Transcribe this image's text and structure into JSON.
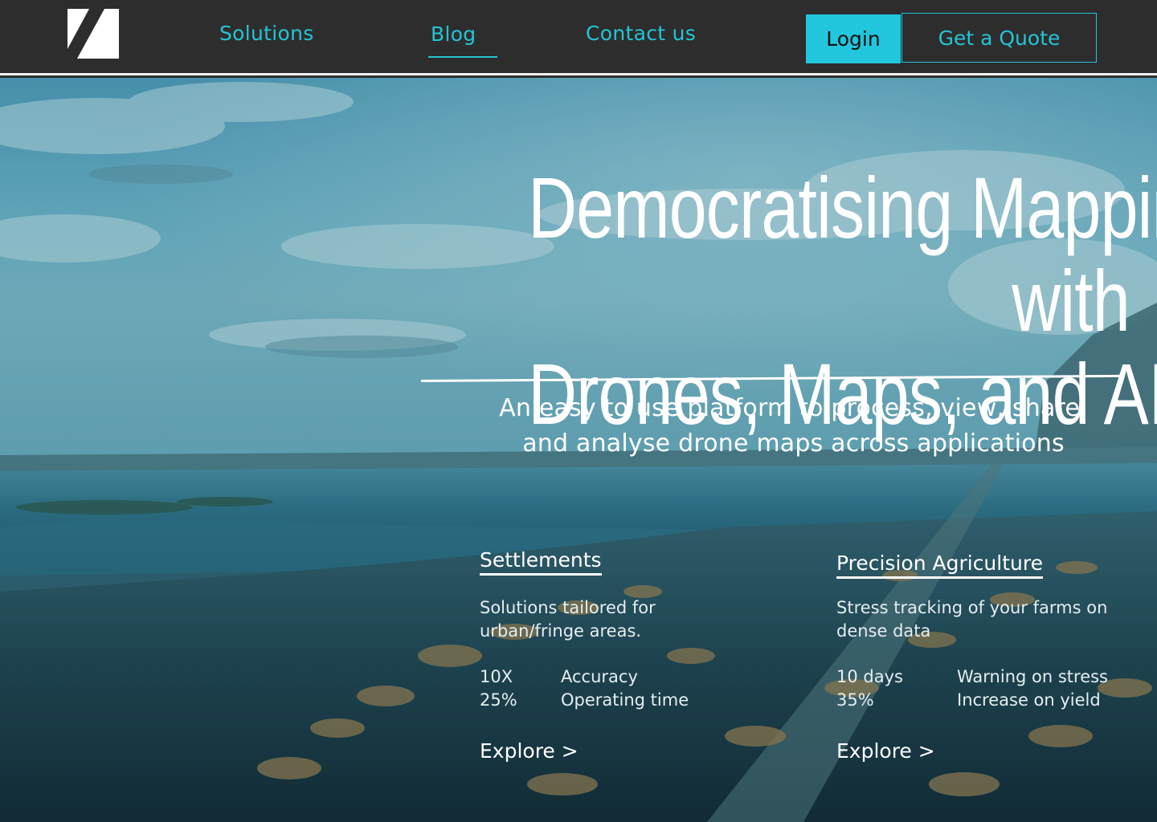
{
  "nav": {
    "logo": "logo",
    "links": [
      "Solutions",
      "Blog",
      "Contact us"
    ],
    "active_link": "Blog",
    "login_label": "Login",
    "quote_label": "Get a Quote"
  },
  "hero": {
    "headline_lines": [
      "Democratising Mapping",
      "with",
      "Drones, Maps, and AI"
    ],
    "subtitle_lines": [
      "An easy to use platform to process, view, share,",
      "and analyse drone maps across applications"
    ]
  },
  "cards": [
    {
      "title": "Settlements",
      "desc_lines": [
        "Solutions tailored for",
        "urban/fringe areas."
      ],
      "stats": [
        {
          "value": "10X",
          "label": "Accuracy"
        },
        {
          "value": "25%",
          "label": "Operating time"
        }
      ],
      "cta": "Explore >"
    },
    {
      "title": "Precision Agriculture",
      "desc_lines": [
        "Stress tracking of your farms on",
        "dense data"
      ],
      "stats": [
        {
          "value": "10 days",
          "label": "Warning on stress"
        },
        {
          "value": "35%",
          "label": " Increase on yield"
        }
      ],
      "cta": "Explore >"
    }
  ],
  "colors": {
    "accent": "#22c6dd",
    "nav_bg": "#2d2d2d",
    "text_light": "#ffffff"
  }
}
